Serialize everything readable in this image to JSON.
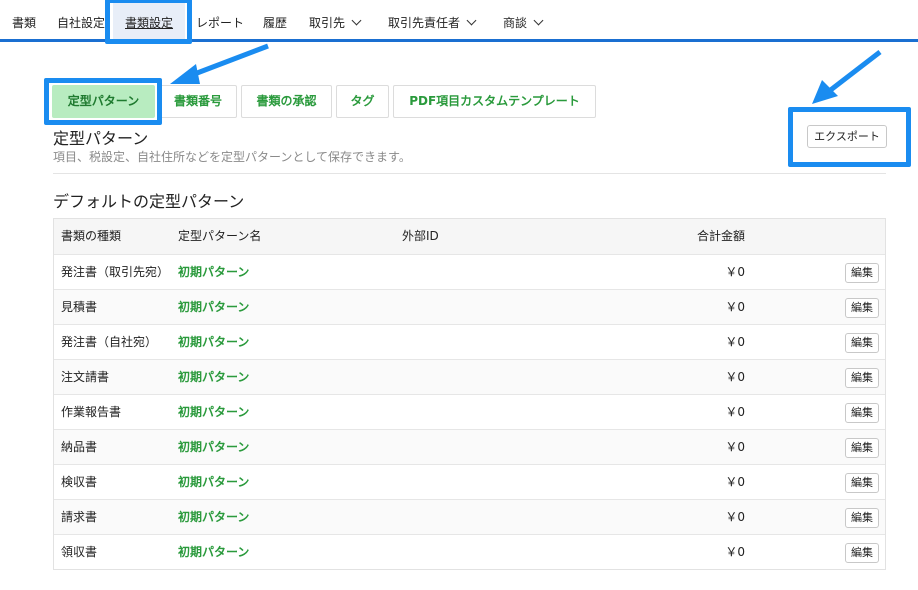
{
  "nav": {
    "items": [
      {
        "label": "書類",
        "dropdown": false
      },
      {
        "label": "自社設定",
        "dropdown": false
      },
      {
        "label": "書類設定",
        "dropdown": false,
        "active": true
      },
      {
        "label": "レポート",
        "dropdown": false
      },
      {
        "label": "履歴",
        "dropdown": false
      },
      {
        "label": "取引先",
        "dropdown": true
      },
      {
        "label": "取引先責任者",
        "dropdown": true
      },
      {
        "label": "商談",
        "dropdown": true
      }
    ]
  },
  "tabs": [
    {
      "label": "定型パターン",
      "active": true
    },
    {
      "label": "書類番号"
    },
    {
      "label": "書類の承認"
    },
    {
      "label": "タグ"
    },
    {
      "label": "PDF項目カスタムテンプレート"
    }
  ],
  "section": {
    "title": "定型パターン",
    "description": "項目、税設定、自社住所などを定型パターンとして保存できます。",
    "export_label": "エクスポート"
  },
  "defaults": {
    "title": "デフォルトの定型パターン",
    "columns": [
      "書類の種類",
      "定型パターン名",
      "外部ID",
      "合計金額"
    ],
    "edit_label": "編集",
    "rows": [
      {
        "type": "発注書（取引先宛）",
        "name": "初期パターン",
        "external_id": "",
        "amount": "￥0"
      },
      {
        "type": "見積書",
        "name": "初期パターン",
        "external_id": "",
        "amount": "￥0"
      },
      {
        "type": "発注書（自社宛）",
        "name": "初期パターン",
        "external_id": "",
        "amount": "￥0"
      },
      {
        "type": "注文請書",
        "name": "初期パターン",
        "external_id": "",
        "amount": "￥0"
      },
      {
        "type": "作業報告書",
        "name": "初期パターン",
        "external_id": "",
        "amount": "￥0"
      },
      {
        "type": "納品書",
        "name": "初期パターン",
        "external_id": "",
        "amount": "￥0"
      },
      {
        "type": "検収書",
        "name": "初期パターン",
        "external_id": "",
        "amount": "￥0"
      },
      {
        "type": "請求書",
        "name": "初期パターン",
        "external_id": "",
        "amount": "￥0"
      },
      {
        "type": "領収書",
        "name": "初期パターン",
        "external_id": "",
        "amount": "￥0"
      }
    ]
  },
  "colors": {
    "accent_blue": "#1a6fd1",
    "highlight_blue": "#1a8cf0",
    "green_text": "#2a9a3c",
    "active_tab_bg": "#b8ecc0"
  }
}
